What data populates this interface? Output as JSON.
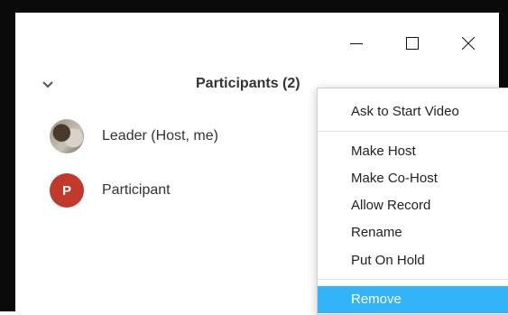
{
  "window": {
    "controls": {
      "minimize_icon": "minimize-icon",
      "maximize_icon": "maximize-icon",
      "close_icon": "close-icon"
    }
  },
  "panel": {
    "title": "Participants (2)",
    "participants": [
      {
        "name": "Leader (Host, me)",
        "avatar": "photo"
      },
      {
        "name": "Participant",
        "avatar_letter": "P",
        "avatar_color": "#c0392b"
      }
    ]
  },
  "context_menu": {
    "items": [
      "Ask to Start Video",
      "Make Host",
      "Make Co-Host",
      "Allow Record",
      "Rename",
      "Put On Hold",
      "Remove"
    ],
    "highlighted": "Remove",
    "highlight_color": "#33b4f8"
  }
}
